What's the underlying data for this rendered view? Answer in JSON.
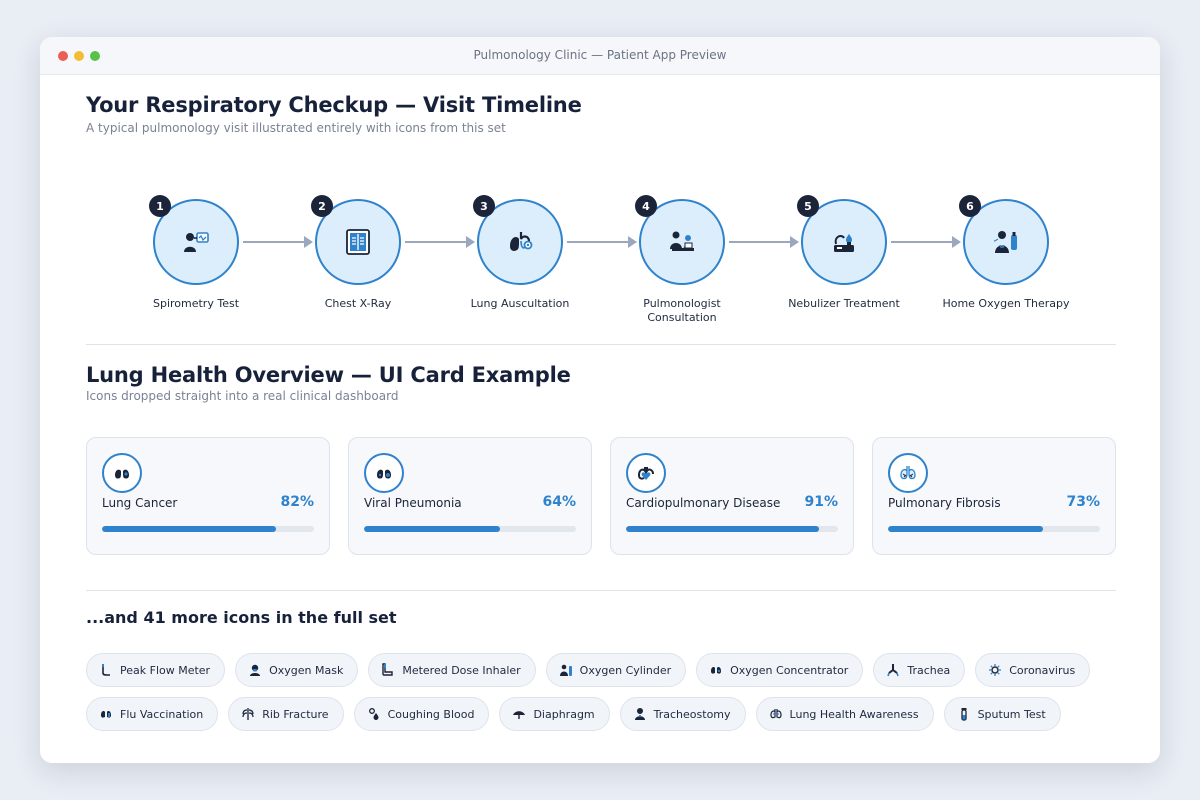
{
  "window": {
    "title": "Pulmonology Clinic — Patient App Preview"
  },
  "timeline": {
    "title": "Your Respiratory Checkup — Visit Timeline",
    "subtitle": "A typical pulmonology visit illustrated entirely with icons from this set",
    "steps": [
      {
        "num": "1",
        "label": "Spirometry Test",
        "icon": "spirometry-icon"
      },
      {
        "num": "2",
        "label": "Chest X-Ray",
        "icon": "chest-xray-icon"
      },
      {
        "num": "3",
        "label": "Lung Auscultation",
        "icon": "lung-auscultation-icon"
      },
      {
        "num": "4",
        "label": "Pulmonologist Consultation",
        "icon": "consultation-icon"
      },
      {
        "num": "5",
        "label": "Nebulizer Treatment",
        "icon": "nebulizer-icon"
      },
      {
        "num": "6",
        "label": "Home Oxygen Therapy",
        "icon": "home-oxygen-icon"
      }
    ]
  },
  "overview": {
    "title": "Lung Health Overview — UI Card Example",
    "subtitle": "Icons dropped straight into a real clinical dashboard",
    "cards": [
      {
        "name": "Lung Cancer",
        "percent": "82%",
        "value": 82,
        "icon": "lung-cancer-icon"
      },
      {
        "name": "Viral Pneumonia",
        "percent": "64%",
        "value": 64,
        "icon": "viral-pneumonia-icon"
      },
      {
        "name": "Cardiopulmonary Disease",
        "percent": "91%",
        "value": 91,
        "icon": "cardiopulmonary-icon"
      },
      {
        "name": "Pulmonary Fibrosis",
        "percent": "73%",
        "value": 73,
        "icon": "pulmonary-fibrosis-icon"
      }
    ]
  },
  "more": {
    "title": "...and 41 more icons in the full set",
    "row1": [
      {
        "label": "Peak Flow Meter",
        "icon": "peak-flow-meter-icon"
      },
      {
        "label": "Oxygen Mask",
        "icon": "oxygen-mask-icon"
      },
      {
        "label": "Metered Dose Inhaler",
        "icon": "inhaler-icon"
      },
      {
        "label": "Oxygen Cylinder",
        "icon": "oxygen-cylinder-icon"
      },
      {
        "label": "Oxygen Concentrator",
        "icon": "oxygen-concentrator-icon"
      },
      {
        "label": "Trachea",
        "icon": "trachea-icon"
      },
      {
        "label": "Coronavirus",
        "icon": "coronavirus-icon"
      }
    ],
    "row2": [
      {
        "label": "Flu Vaccination",
        "icon": "flu-vaccination-icon"
      },
      {
        "label": "Rib Fracture",
        "icon": "rib-fracture-icon"
      },
      {
        "label": "Coughing Blood",
        "icon": "coughing-blood-icon"
      },
      {
        "label": "Diaphragm",
        "icon": "diaphragm-icon"
      },
      {
        "label": "Tracheostomy",
        "icon": "tracheostomy-icon"
      },
      {
        "label": "Lung Health Awareness",
        "icon": "lung-awareness-icon"
      },
      {
        "label": "Sputum Test",
        "icon": "sputum-test-icon"
      }
    ]
  },
  "colors": {
    "accent": "#2f82cc",
    "dark": "#1b2438",
    "circle_fill": "#dceefc"
  }
}
